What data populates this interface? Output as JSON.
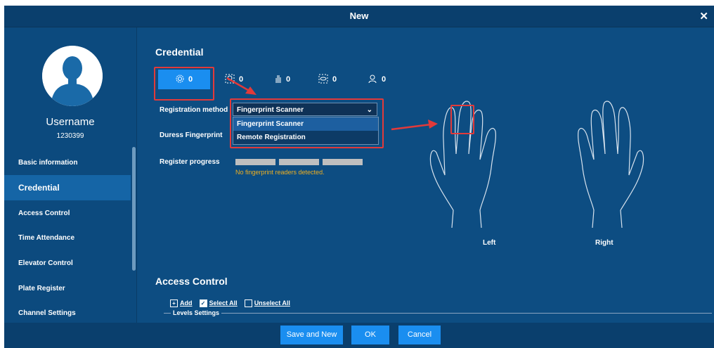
{
  "dialog": {
    "title": "New",
    "close_icon": "close-icon"
  },
  "sidebar": {
    "username": "Username",
    "user_id": "1230399",
    "items": [
      {
        "label": "Basic information"
      },
      {
        "label": "Credential",
        "active": true
      },
      {
        "label": "Access Control"
      },
      {
        "label": "Time Attendance"
      },
      {
        "label": "Elevator Control"
      },
      {
        "label": "Plate Register"
      },
      {
        "label": "Channel Settings"
      }
    ]
  },
  "credential": {
    "heading": "Credential",
    "tabs": [
      {
        "icon": "fingerprint-icon",
        "count": "0",
        "active": true
      },
      {
        "icon": "face-icon",
        "count": "0"
      },
      {
        "icon": "palm-icon",
        "count": "0"
      },
      {
        "icon": "iris-icon",
        "count": "0"
      },
      {
        "icon": "person-icon",
        "count": "0"
      }
    ],
    "registration_label": "Registration method",
    "registration_value": "Fingerprint Scanner",
    "registration_options": [
      "Fingerprint Scanner",
      "Remote Registration"
    ],
    "duress_label": "Duress Fingerprint",
    "progress_label": "Register progress",
    "progress_segments": 3,
    "warning": "No fingerprint readers detected.",
    "left_hand": "Left",
    "right_hand": "Right"
  },
  "access_control": {
    "heading": "Access Control",
    "add": "Add",
    "select_all": "Select All",
    "unselect_all": "Unselect All",
    "levels_settings": "Levels Settings"
  },
  "footer": {
    "save_new": "Save and New",
    "ok": "OK",
    "cancel": "Cancel"
  },
  "colors": {
    "dialog_bg": "#0d4d82",
    "accent": "#1a8ef0",
    "annotation_red": "#e23a3a",
    "warning": "#f0b020"
  }
}
